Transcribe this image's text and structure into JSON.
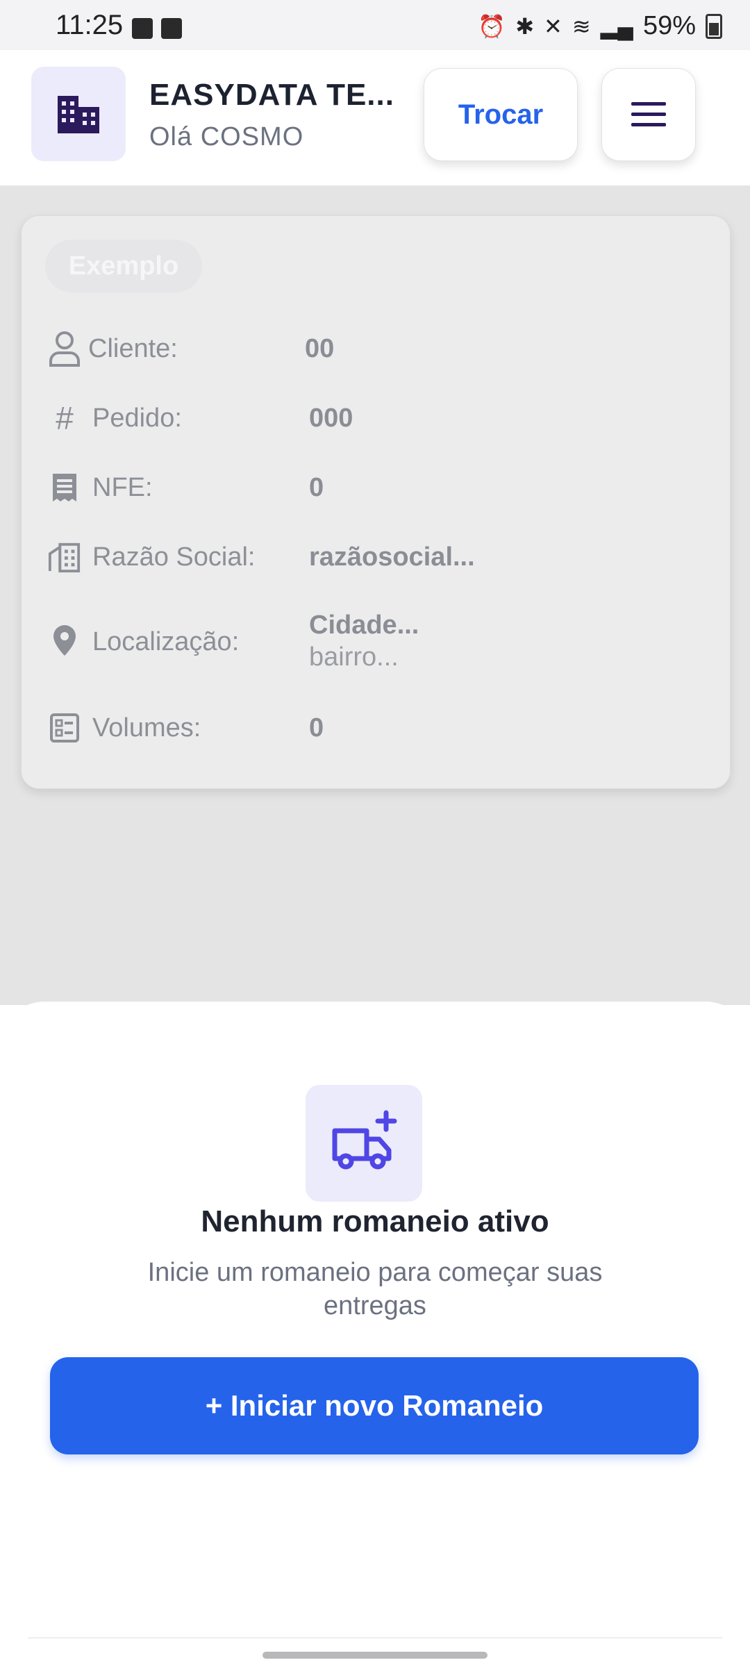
{
  "status_bar": {
    "time": "11:25",
    "battery": "59%"
  },
  "header": {
    "org_name": "EASYDATA TE...",
    "greeting": "Olá COSMO",
    "switch_label": "Trocar",
    "org_icon": "building-icon",
    "menu_icon": "hamburger-menu-icon"
  },
  "card": {
    "chip": "Exemplo",
    "rows": [
      {
        "icon": "user-icon",
        "label": "Cliente:",
        "value": "00"
      },
      {
        "icon": "hash-icon",
        "label": "Pedido:",
        "value": "000"
      },
      {
        "icon": "receipt-icon",
        "label": "NFE:",
        "value": "0"
      },
      {
        "icon": "building-icon",
        "label": "Razão Social:",
        "value": "razãosocial..."
      },
      {
        "icon": "location-pin-icon",
        "label": "Localização:",
        "value": "Cidade...",
        "value2": "bairro..."
      },
      {
        "icon": "list-icon",
        "label": "Volumes:",
        "value": "0"
      }
    ]
  },
  "sheet": {
    "icon": "truck-plus-icon",
    "title": "Nenhum romaneio ativo",
    "subtitle": "Inicie um romaneio para começar suas entregas",
    "button_label": "+ Iniciar novo Romaneio"
  },
  "colors": {
    "accent": "#2563eb",
    "icon_dark": "#2b1a5c",
    "icon_bg": "#ecebfb",
    "truck_icon": "#4f46e5"
  }
}
